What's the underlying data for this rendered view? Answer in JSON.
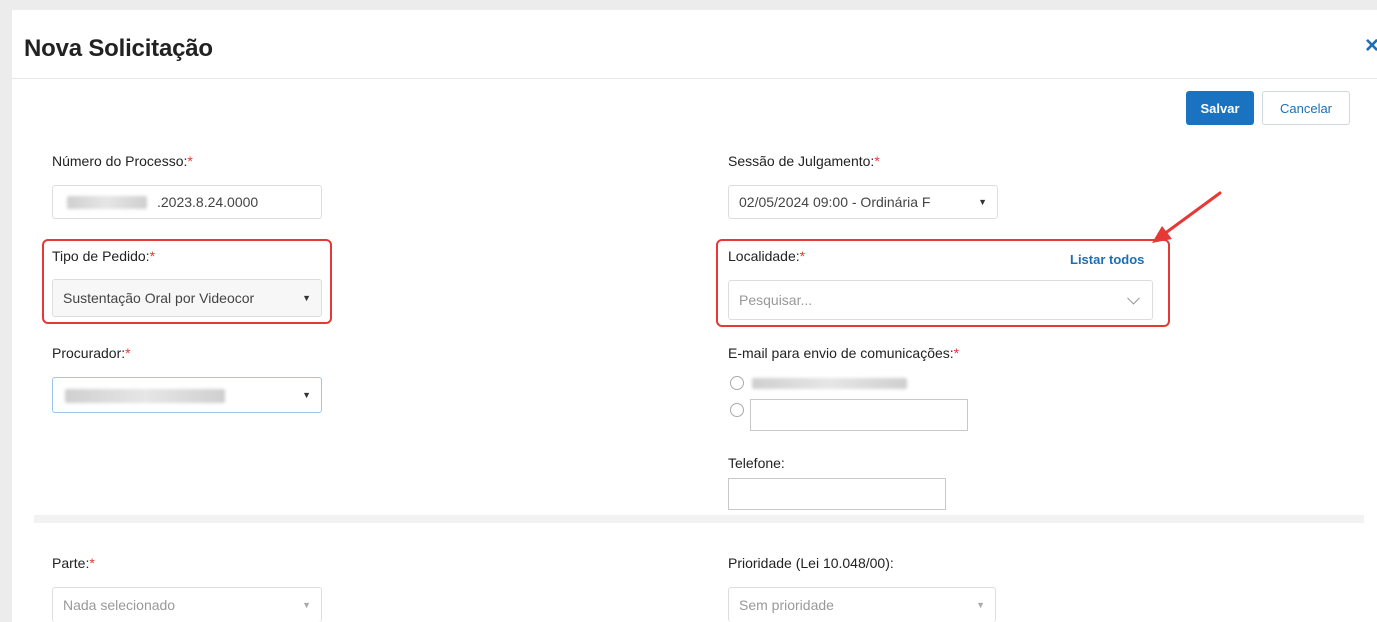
{
  "modal": {
    "title": "Nova Solicitação",
    "close_symbol": "×"
  },
  "toolbar": {
    "save_label": "Salvar",
    "cancel_label": "Cancelar"
  },
  "form": {
    "numero_processo": {
      "label": "Número do Processo:",
      "required_mark": "*",
      "value": ".2023.8.24.0000"
    },
    "sessao": {
      "label": "Sessão de Julgamento:",
      "required_mark": "*",
      "value": "02/05/2024 09:00 - Ordinária F"
    },
    "tipo_pedido": {
      "label": "Tipo de Pedido:",
      "required_mark": "*",
      "value": "Sustentação Oral por Videocor"
    },
    "localidade": {
      "label": "Localidade:",
      "required_mark": "*",
      "link": "Listar todos",
      "placeholder": "Pesquisar..."
    },
    "procurador": {
      "label": "Procurador:",
      "required_mark": "*"
    },
    "email": {
      "label": "E-mail para envio de comunicações:",
      "required_mark": "*"
    },
    "telefone": {
      "label": "Telefone:"
    },
    "parte": {
      "label": "Parte:",
      "required_mark": "*",
      "value": "Nada selecionado"
    },
    "prioridade": {
      "label": "Prioridade (Lei 10.048/00):",
      "value": "Sem prioridade"
    }
  },
  "icons": {
    "caret": "caret-down-icon",
    "chevron": "chevron-down-icon",
    "arrow": "red-arrow-annotation"
  },
  "colors": {
    "primary": "#1a73c1",
    "highlight": "#e53935",
    "required": "#e53935"
  }
}
